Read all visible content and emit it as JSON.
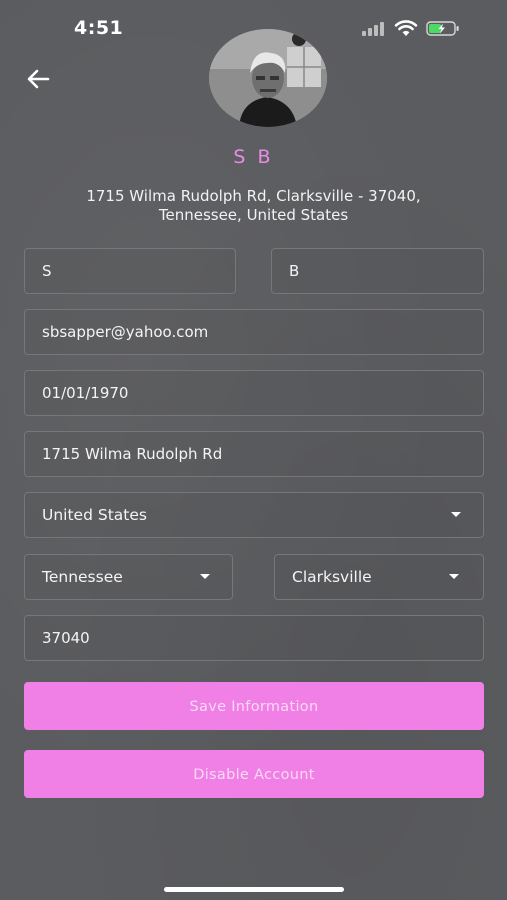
{
  "status_bar": {
    "time": "4:51"
  },
  "profile": {
    "name": "S B",
    "address_line1": "1715 Wilma Rudolph Rd, Clarksville - 37040,",
    "address_line2": "Tennessee, United States"
  },
  "form": {
    "first_name": "S",
    "last_name": "B",
    "email": "sbsapper@yahoo.com",
    "dob": "01/01/1970",
    "street": "1715 Wilma Rudolph Rd",
    "country": "United States",
    "state": "Tennessee",
    "city": "Clarksville",
    "zip": "37040"
  },
  "buttons": {
    "save": "Save Information",
    "disable": "Disable Account"
  },
  "colors": {
    "accent": "#f07fe6",
    "name_text": "#e98de4",
    "background": "#5b5c5f",
    "battery_charge": "#4cd964"
  },
  "icons": [
    "signal-icon",
    "wifi-icon",
    "battery-charging-icon",
    "back-arrow-icon",
    "chevron-down-icon"
  ]
}
